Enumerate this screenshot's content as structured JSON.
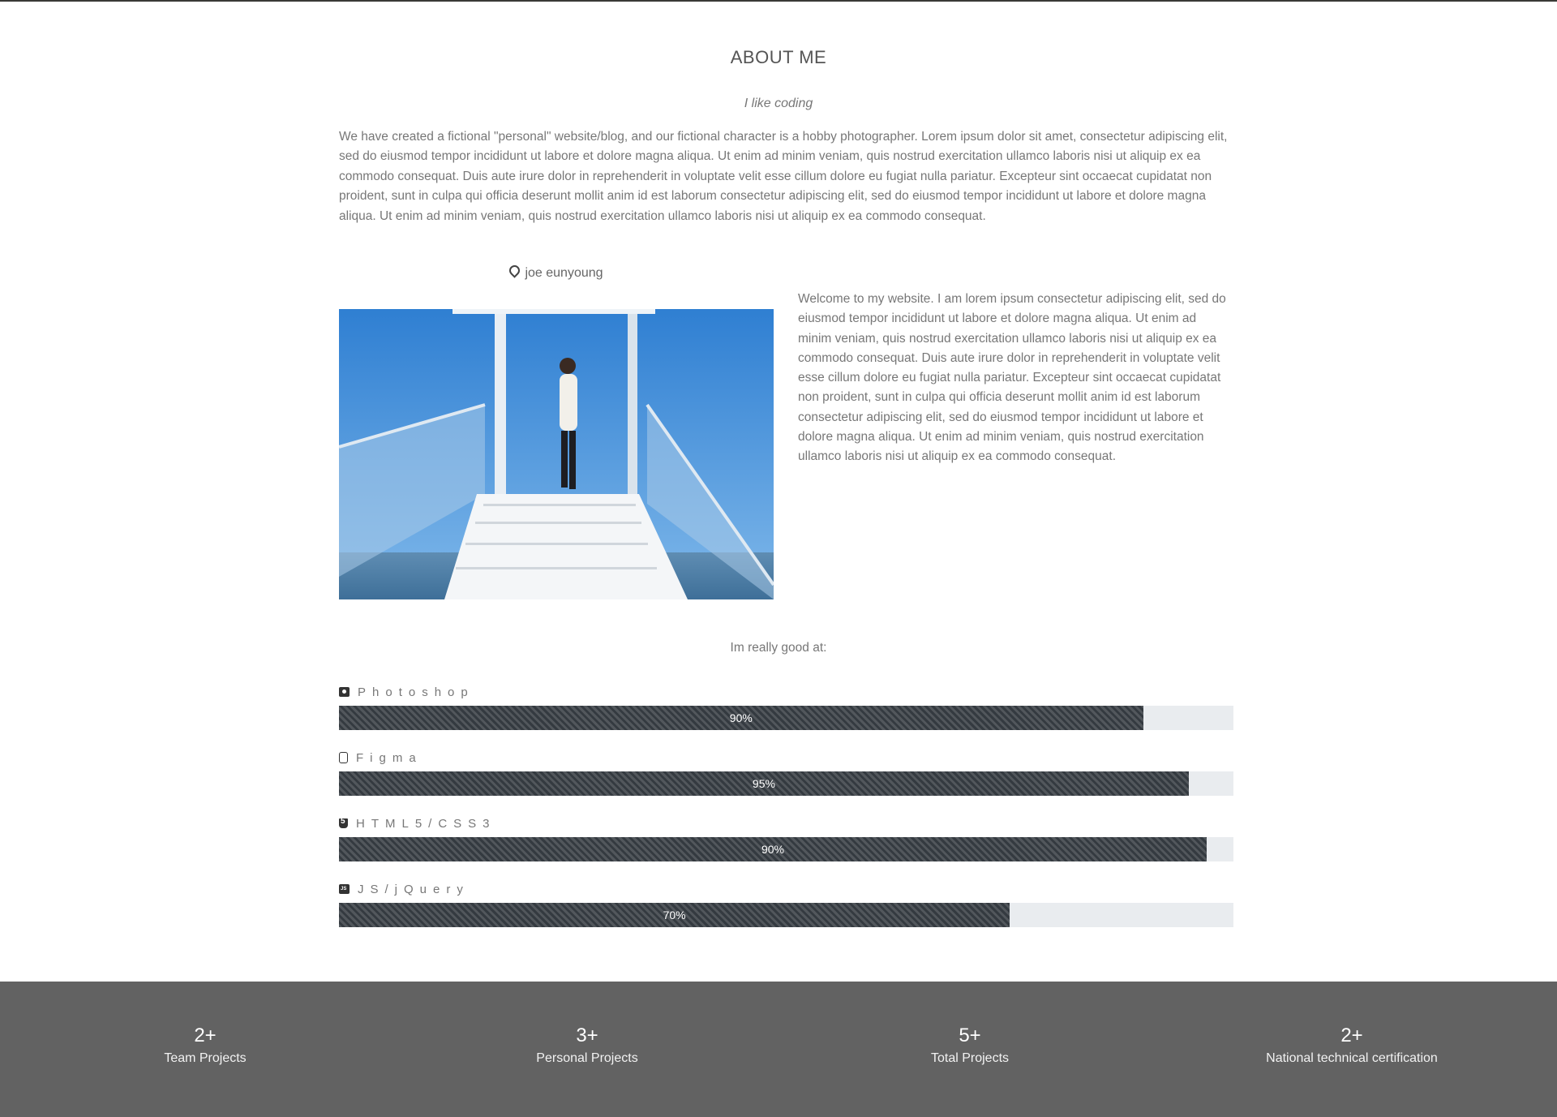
{
  "about": {
    "title": "ABOUT ME",
    "subtitle": "I like coding",
    "intro": "We have created a fictional \"personal\" website/blog, and our fictional character is a hobby photographer. Lorem ipsum dolor sit amet, consectetur adipiscing elit, sed do eiusmod tempor incididunt ut labore et dolore magna aliqua. Ut enim ad minim veniam, quis nostrud exercitation ullamco laboris nisi ut aliquip ex ea commodo consequat. Duis aute irure dolor in reprehenderit in voluptate velit esse cillum dolore eu fugiat nulla pariatur. Excepteur sint occaecat cupidatat non proident, sunt in culpa qui officia deserunt mollit anim id est laborum consectetur adipiscing elit, sed do eiusmod tempor incididunt ut labore et dolore magna aliqua. Ut enim ad minim veniam, quis nostrud exercitation ullamco laboris nisi ut aliquip ex ea commodo consequat."
  },
  "profile": {
    "name": "joe eunyoung",
    "icon": "map-marker-icon",
    "bio": "Welcome to my website. I am lorem ipsum consectetur adipiscing elit, sed do eiusmod tempor incididunt ut labore et dolore magna aliqua. Ut enim ad minim veniam, quis nostrud exercitation ullamco laboris nisi ut aliquip ex ea commodo consequat. Duis aute irure dolor in reprehenderit in voluptate velit esse cillum dolore eu fugiat nulla pariatur. Excepteur sint occaecat cupidatat non proident, sunt in culpa qui officia deserunt mollit anim id est laborum consectetur adipiscing elit, sed do eiusmod tempor incididunt ut labore et dolore magna aliqua. Ut enim ad minim veniam, quis nostrud exercitation ullamco laboris nisi ut aliquip ex ea commodo consequat."
  },
  "skills": {
    "title": "Im really good at:",
    "items": [
      {
        "label": "Photoshop",
        "icon": "camera-icon",
        "percent_text": "90%",
        "fill": 0.899
      },
      {
        "label": "Figma",
        "icon": "figma-icon",
        "percent_text": "95%",
        "fill": 0.95
      },
      {
        "label": "HTML5/CSS3",
        "icon": "html5-icon",
        "percent_text": "90%",
        "fill": 0.97
      },
      {
        "label": "JS/jQuery",
        "icon": "js-icon",
        "percent_text": "70%",
        "fill": 0.75
      }
    ]
  },
  "stats": [
    {
      "number": "2+",
      "label": "Team Projects"
    },
    {
      "number": "3+",
      "label": "Personal Projects"
    },
    {
      "number": "5+",
      "label": "Total Projects"
    },
    {
      "number": "2+",
      "label": "National technical certification"
    }
  ],
  "colors": {
    "bar": "#343a40",
    "track": "#e9ecef",
    "footer": "#626262"
  }
}
